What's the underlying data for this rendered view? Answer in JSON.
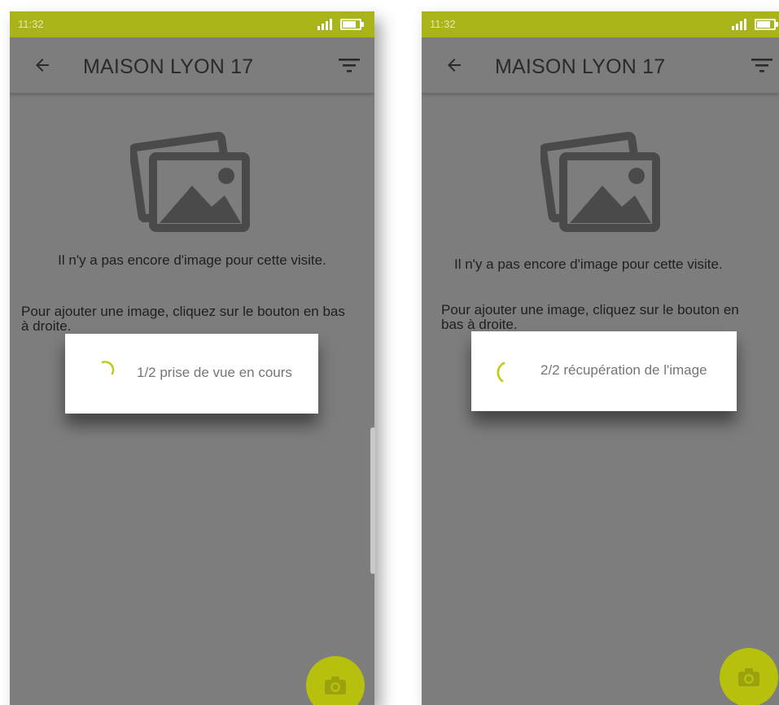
{
  "screens": [
    {
      "status_time": "11:32",
      "title": "MAISON LYON 17",
      "empty_message": "Il n'y a pas encore d'image pour cette visite.",
      "hint_message": "Pour ajouter une image, cliquez sur le bouton en bas à droite.",
      "progress_text": "1/2 prise de vue en cours"
    },
    {
      "status_time": "11:32",
      "title": "MAISON LYON 17",
      "empty_message": "Il n'y a pas encore d'image pour cette visite.",
      "hint_message": "Pour ajouter une image, cliquez sur le bouton en bas à droite.",
      "progress_text": "2/2 récupération de l'image"
    }
  ],
  "colors": {
    "statusbar": "#a9b31a",
    "accent": "#b8c00e",
    "overlay": "#7d7d7d",
    "icon_gray": "#4a4a4a"
  },
  "icons": {
    "back": "arrow-left-icon",
    "filter": "filter-icon",
    "gallery": "image-gallery-icon",
    "camera": "camera-icon",
    "spinner": "spinner-icon",
    "signal": "signal-icon",
    "battery": "battery-icon"
  }
}
